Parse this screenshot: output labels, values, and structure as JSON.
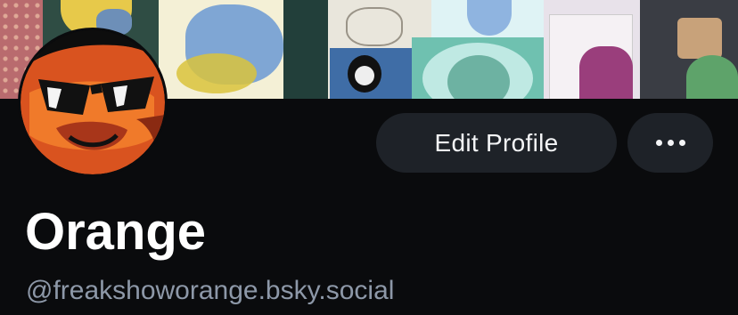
{
  "profile": {
    "display_name": "Orange",
    "handle": "@freakshoworange.bsky.social"
  },
  "actions": {
    "edit_profile_label": "Edit Profile",
    "more_icon": "ellipsis-icon"
  },
  "colors": {
    "background": "#0a0b0d",
    "button_bg": "#1e2228",
    "button_text": "#f4f5f7",
    "handle_text": "#8d98a8"
  }
}
